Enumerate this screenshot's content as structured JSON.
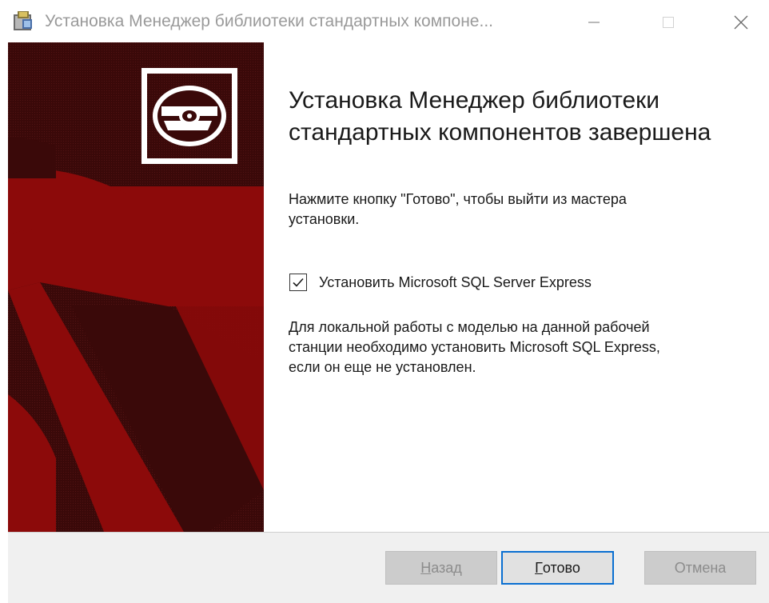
{
  "window": {
    "title": "Установка Менеджер библиотеки стандартных компоне...",
    "controls": {
      "minimize": "minimize-icon",
      "maximize": "maximize-icon",
      "close": "close-icon"
    }
  },
  "main": {
    "heading_line1": "Установка Менеджер библиотеки",
    "heading_line2": "стандартных компонентов завершена",
    "instruction_line1": "Нажмите кнопку \"Готово\", чтобы выйти из мастера",
    "instruction_line2": "установки.",
    "checkbox": {
      "label": "Установить Microsoft SQL Server Express",
      "checked": true
    },
    "note_line1": "Для локальной работы с моделью на данной рабочей",
    "note_line2": "станции необходимо установить Microsoft SQL Express,",
    "note_line3": "если он еще не установлен."
  },
  "buttons": {
    "back": {
      "accel": "Н",
      "rest": "азад",
      "enabled": false
    },
    "finish": {
      "accel": "Г",
      "rest": "отово",
      "enabled": true
    },
    "cancel": {
      "label": "Отмена",
      "enabled": false
    }
  },
  "colors": {
    "banner_dark": "#3a0909",
    "banner_red": "#8c0a0a",
    "focus_border": "#0a6fd1",
    "disabled_button": "#cccccc"
  }
}
